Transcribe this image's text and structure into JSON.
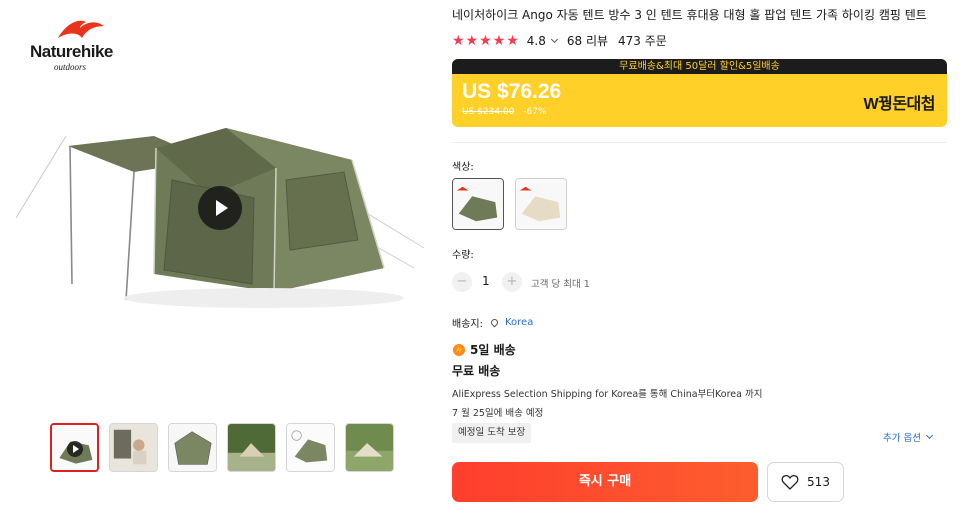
{
  "brand": {
    "name": "Naturehike",
    "tagline": "outdoors"
  },
  "gallery": {
    "thumbnail_count": 6,
    "active_thumbnail": 0
  },
  "product": {
    "title": "네이처하이크 Ango 자동 텐트 방수 3 인 텐트 휴대용 대형 홀 팝업 텐트 가족 하이킹 캠핑 텐트",
    "stars": "★★★★★",
    "rating": "4.8",
    "reviews": "68 리뷰",
    "orders": "473 주문"
  },
  "promo": {
    "banner": "무료배송&최대 50달러 할인&5일배송",
    "price": "US $76.26",
    "original_price": "US $234.00",
    "discount": "-67%",
    "event_label": "W꿩돈대첩",
    "bg_color": "#ffd028",
    "banner_color": "#1c1c1c"
  },
  "color": {
    "label": "색상:",
    "options": [
      "army-green",
      "beige"
    ]
  },
  "quantity": {
    "label": "수량:",
    "minus": "−",
    "value": "1",
    "plus": "+",
    "limit": "고객 당 최대 1"
  },
  "shipping": {
    "label": "배송지:",
    "country": "Korea",
    "fast": "5일 배송",
    "free": "무료 배송",
    "description": "AliExpress Selection Shipping for Korea를 통해 China부터Korea 까지",
    "date": "7 월 25일에 배송 예정",
    "guarantee": "예정일 도착 보장",
    "more_options": "추가 옵션"
  },
  "actions": {
    "buy_now": "즉시 구매",
    "wishlist_count": "513",
    "buy_color": "#ff4733"
  }
}
